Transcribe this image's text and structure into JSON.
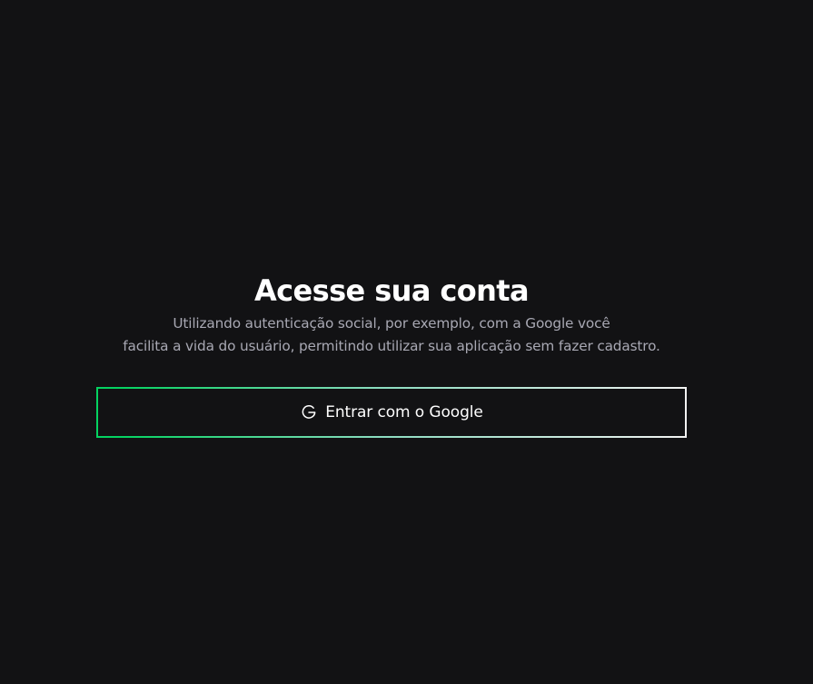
{
  "page": {
    "title": "Acesse sua conta",
    "subtitle_lines": [
      "Utilizando autenticação social, por exemplo, com a Google você",
      "facilita a vida do usuário, permitindo utilizar sua aplicação sem fazer cadastro."
    ]
  },
  "login_button": {
    "label": "Entrar com o Google",
    "icon": "google-icon"
  },
  "colors": {
    "background": "#121214",
    "title": "#ffffff",
    "subtitle": "#a8a8b3",
    "button_border_start": "#04d361",
    "button_border_end": "#f2f2f2",
    "button_text": "#ffffff"
  }
}
